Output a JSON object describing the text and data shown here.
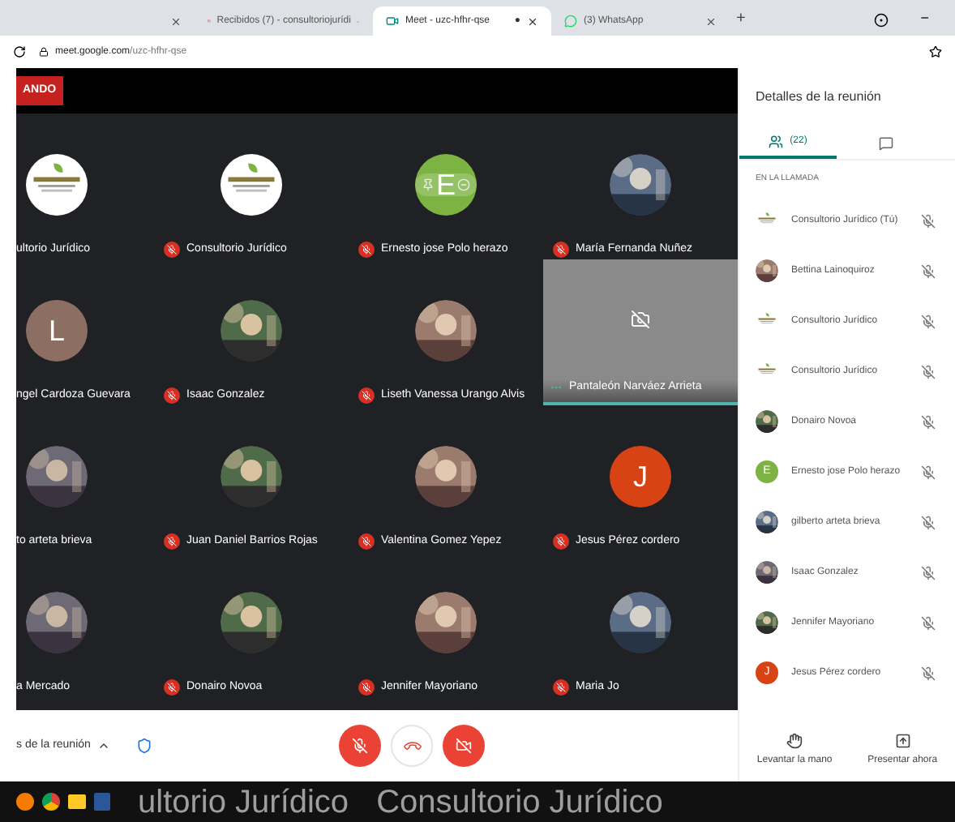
{
  "browser": {
    "tabs": [
      {
        "kind": "blank",
        "selected": false
      },
      {
        "title": "Recibidos (7) - consultoriojurídi",
        "kind": "mail",
        "selected": false
      },
      {
        "title": "Meet - uzc-hfhr-qse",
        "kind": "meet",
        "selected": true,
        "recording_dot": "●"
      },
      {
        "title": "(3) WhatsApp",
        "kind": "whatsapp",
        "selected": false
      }
    ],
    "new_tab": "+",
    "window_min": "−",
    "url_host": "meet.google.com",
    "url_path": "/uzc-hfhr-qse"
  },
  "recording_badge": "ANDO",
  "tiles": [
    {
      "name": "ultorio Jurídico",
      "avatar": {
        "kind": "logo"
      }
    },
    {
      "name": "Consultorio Jurídico",
      "avatar": {
        "kind": "logo"
      },
      "muted": true
    },
    {
      "name": "Ernesto jose Polo herazo",
      "avatar": {
        "kind": "letter",
        "letter": "E",
        "color": "#7cb342"
      },
      "muted": true,
      "hover": true
    },
    {
      "name": "María Fernanda Nuñez",
      "muted": true
    },
    {
      "name": "ngel Cardoza Guevara",
      "avatar": {
        "kind": "letter",
        "letter": "L",
        "color": "#8d6e63"
      }
    },
    {
      "name": "Isaac Gonzalez",
      "muted": true
    },
    {
      "name": "Liseth Vanessa Urango Alvis",
      "muted": true
    },
    {
      "name": "Pantaleón Narváez Arrieta",
      "avatar": {
        "kind": "camera_off"
      },
      "speaking": true
    },
    {
      "name": "to arteta brieva"
    },
    {
      "name": "Juan Daniel Barrios Rojas",
      "muted": true
    },
    {
      "name": "Valentina Gomez Yepez",
      "muted": true
    },
    {
      "name": "Jesus Pérez cordero",
      "avatar": {
        "kind": "letter",
        "letter": "J",
        "color": "#d84315"
      },
      "muted": true
    },
    {
      "name": "a Mercado"
    },
    {
      "name": "Donairo Novoa",
      "muted": true
    },
    {
      "name": "Jennifer Mayoriano",
      "muted": true
    },
    {
      "name": "Maria Jo",
      "muted": true
    }
  ],
  "controls": {
    "details_label": "s de la reunión",
    "mic_muted": true,
    "camera_off": true
  },
  "panel": {
    "title": "Detalles de la reunión",
    "tabs": [
      {
        "kind": "people",
        "label": "(22)",
        "selected": true
      },
      {
        "kind": "chat",
        "selected": false
      }
    ],
    "section": "EN LA LLAMADA",
    "participants": [
      {
        "name": "Consultorio Jurídico (Tú)",
        "avatar": {
          "kind": "logo"
        },
        "muted": true
      },
      {
        "name": "Bettina Lainoquiroz",
        "muted": true
      },
      {
        "name": "Consultorio Jurídico",
        "avatar": {
          "kind": "logo"
        },
        "muted": true
      },
      {
        "name": "Consultorio Jurídico",
        "avatar": {
          "kind": "logo"
        },
        "muted": true
      },
      {
        "name": "Donairo Novoa",
        "muted": true
      },
      {
        "name": "Ernesto jose Polo herazo",
        "avatar": {
          "kind": "letter",
          "letter": "E",
          "color": "#7cb342"
        },
        "muted": true
      },
      {
        "name": "gilberto arteta brieva",
        "muted": true
      },
      {
        "name": "Isaac Gonzalez",
        "muted": true
      },
      {
        "name": "Jennifer Mayoriano",
        "muted": true
      },
      {
        "name": "Jesus Pérez cordero",
        "avatar": {
          "kind": "letter",
          "letter": "J",
          "color": "#d84315"
        },
        "muted": true
      }
    ],
    "actions": [
      {
        "kind": "hand",
        "label": "Levantar la mano"
      },
      {
        "kind": "present",
        "label": "Presentar ahora"
      }
    ]
  },
  "taskbar": {
    "window_titles": [
      "ultorio Jurídico",
      "Consultorio Jurídico"
    ]
  }
}
